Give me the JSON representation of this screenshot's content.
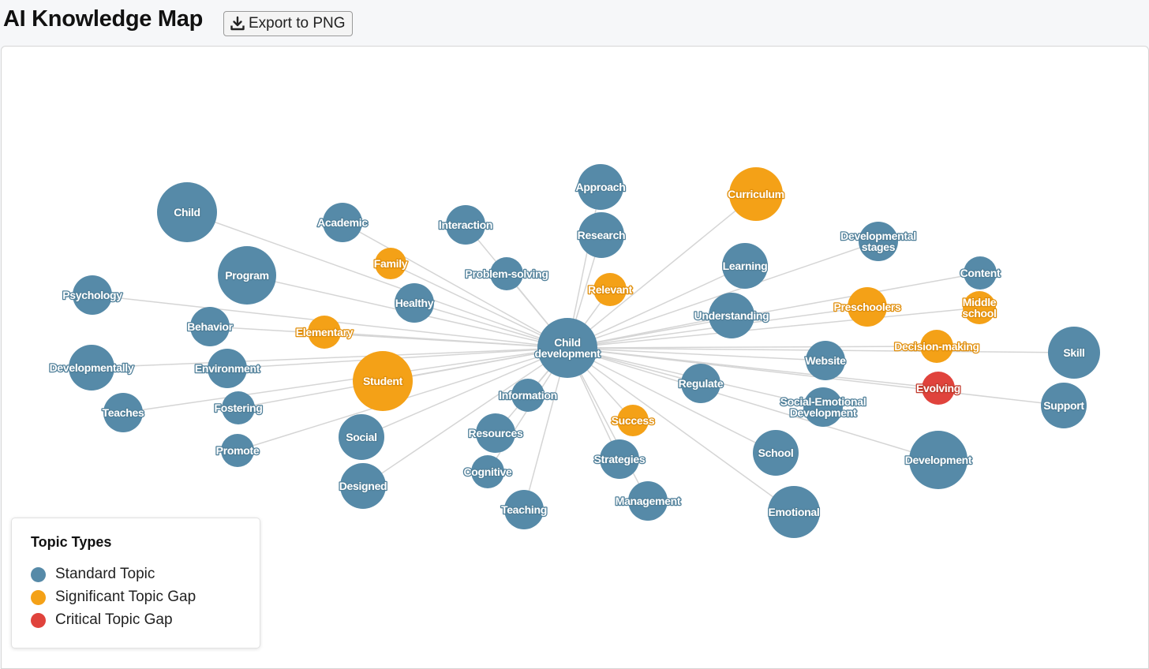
{
  "header": {
    "title": "AI Knowledge Map",
    "export_label": "Export to PNG",
    "export_icon": "download-icon"
  },
  "colors": {
    "standard": "#568aa8",
    "significant": "#f4a117",
    "critical": "#e0433c",
    "edge": "#d5d5d5"
  },
  "graph": {
    "center": {
      "id": "child-development",
      "label": "Child\ndevelopment",
      "type": "standard"
    },
    "nodes": [
      {
        "id": "child",
        "label": "Child",
        "type": "standard"
      },
      {
        "id": "academic",
        "label": "Academic",
        "type": "standard"
      },
      {
        "id": "interaction",
        "label": "Interaction",
        "type": "standard"
      },
      {
        "id": "approach",
        "label": "Approach",
        "type": "standard"
      },
      {
        "id": "curriculum",
        "label": "Curriculum",
        "type": "significant"
      },
      {
        "id": "research",
        "label": "Research",
        "type": "standard"
      },
      {
        "id": "program",
        "label": "Program",
        "type": "standard"
      },
      {
        "id": "family",
        "label": "Family",
        "type": "significant"
      },
      {
        "id": "problem-solving",
        "label": "Problem-solving",
        "type": "standard"
      },
      {
        "id": "developmental-stages",
        "label": "Developmental\nstages",
        "type": "standard"
      },
      {
        "id": "learning",
        "label": "Learning",
        "type": "standard"
      },
      {
        "id": "content",
        "label": "Content",
        "type": "standard"
      },
      {
        "id": "psychology",
        "label": "Psychology",
        "type": "standard"
      },
      {
        "id": "healthy",
        "label": "Healthy",
        "type": "standard"
      },
      {
        "id": "relevant",
        "label": "Relevant",
        "type": "significant"
      },
      {
        "id": "preschoolers",
        "label": "Preschoolers",
        "type": "significant"
      },
      {
        "id": "middle-school",
        "label": "Middle\nschool",
        "type": "significant"
      },
      {
        "id": "understanding",
        "label": "Understanding",
        "type": "standard"
      },
      {
        "id": "behavior",
        "label": "Behavior",
        "type": "standard"
      },
      {
        "id": "elementary",
        "label": "Elementary",
        "type": "significant"
      },
      {
        "id": "decision-making",
        "label": "Decision-making",
        "type": "significant"
      },
      {
        "id": "skill",
        "label": "Skill",
        "type": "standard"
      },
      {
        "id": "website",
        "label": "Website",
        "type": "standard"
      },
      {
        "id": "developmentally",
        "label": "Developmentally",
        "type": "standard"
      },
      {
        "id": "environment",
        "label": "Environment",
        "type": "standard"
      },
      {
        "id": "student",
        "label": "Student",
        "type": "significant"
      },
      {
        "id": "regulate",
        "label": "Regulate",
        "type": "standard"
      },
      {
        "id": "evolving",
        "label": "Evolving",
        "type": "critical"
      },
      {
        "id": "information",
        "label": "Information",
        "type": "standard"
      },
      {
        "id": "support",
        "label": "Support",
        "type": "standard"
      },
      {
        "id": "teaches",
        "label": "Teaches",
        "type": "standard"
      },
      {
        "id": "fostering",
        "label": "Fostering",
        "type": "standard"
      },
      {
        "id": "social-emotional-development",
        "label": "Social-Emotional\nDevelopment",
        "type": "standard"
      },
      {
        "id": "success",
        "label": "Success",
        "type": "significant"
      },
      {
        "id": "resources",
        "label": "Resources",
        "type": "standard"
      },
      {
        "id": "social",
        "label": "Social",
        "type": "standard"
      },
      {
        "id": "school",
        "label": "School",
        "type": "standard"
      },
      {
        "id": "development",
        "label": "Development",
        "type": "standard"
      },
      {
        "id": "promote",
        "label": "Promote",
        "type": "standard"
      },
      {
        "id": "strategies",
        "label": "Strategies",
        "type": "standard"
      },
      {
        "id": "cognitive",
        "label": "Cognitive",
        "type": "standard"
      },
      {
        "id": "designed",
        "label": "Designed",
        "type": "standard"
      },
      {
        "id": "management",
        "label": "Management",
        "type": "standard"
      },
      {
        "id": "teaching",
        "label": "Teaching",
        "type": "standard"
      },
      {
        "id": "emotional",
        "label": "Emotional",
        "type": "standard"
      }
    ]
  },
  "legend": {
    "title": "Topic Types",
    "items": [
      {
        "label": "Standard Topic",
        "type": "standard"
      },
      {
        "label": "Significant Topic Gap",
        "type": "significant"
      },
      {
        "label": "Critical Topic Gap",
        "type": "critical"
      }
    ]
  }
}
